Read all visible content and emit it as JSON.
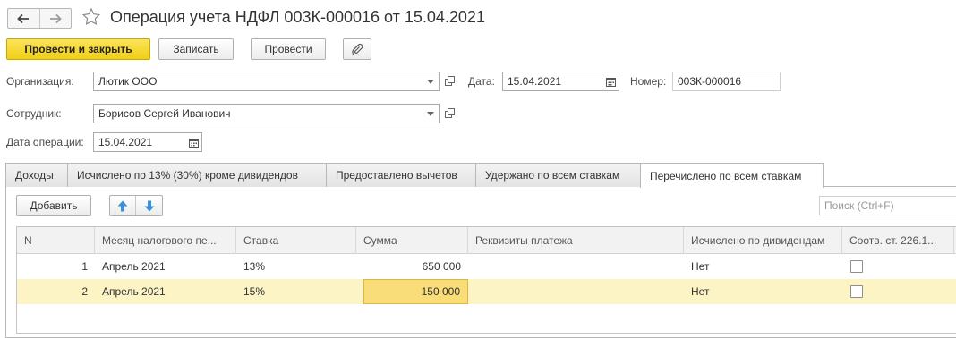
{
  "window": {
    "title": "Операция учета НДФЛ 003К-000016 от 15.04.2021"
  },
  "toolbar": {
    "post_close_label": "Провести и закрыть",
    "save_label": "Записать",
    "post_label": "Провести"
  },
  "form": {
    "organization_label": "Организация:",
    "organization_value": "Лютик ООО",
    "date_label": "Дата:",
    "date_value": "15.04.2021",
    "number_label": "Номер:",
    "number_value": "003К-000016",
    "employee_label": "Сотрудник:",
    "employee_value": "Борисов Сергей Иванович",
    "op_date_label": "Дата операции:",
    "op_date_value": "15.04.2021"
  },
  "tabs": [
    {
      "label": "Доходы"
    },
    {
      "label": "Исчислено по 13% (30%) кроме дивидендов"
    },
    {
      "label": "Предоставлено вычетов"
    },
    {
      "label": "Удержано по всем ставкам"
    },
    {
      "label": "Перечислено по всем ставкам"
    }
  ],
  "active_tab": "Перечислено по всем ставкам",
  "table_toolbar": {
    "add_label": "Добавить",
    "search_placeholder": "Поиск (Ctrl+F)"
  },
  "table": {
    "columns": [
      "N",
      "Месяц налогового пе...",
      "Ставка",
      "Сумма",
      "Реквизиты платежа",
      "Исчислено по дивидендам",
      "Соотв. ст. 226.1..."
    ],
    "rows": [
      {
        "n": "1",
        "month": "Апрель 2021",
        "rate": "13%",
        "sum": "650 000",
        "details": "",
        "dividends": "Нет",
        "art_226": false
      },
      {
        "n": "2",
        "month": "Апрель 2021",
        "rate": "15%",
        "sum": "150 000",
        "details": "",
        "dividends": "Нет",
        "art_226": false
      }
    ]
  },
  "colors": {
    "primary_button": "#f1cf16",
    "selected_row": "#fcf4c5",
    "current_cell": "#f9dd78",
    "arrow_blue": "#3b8ed8"
  }
}
